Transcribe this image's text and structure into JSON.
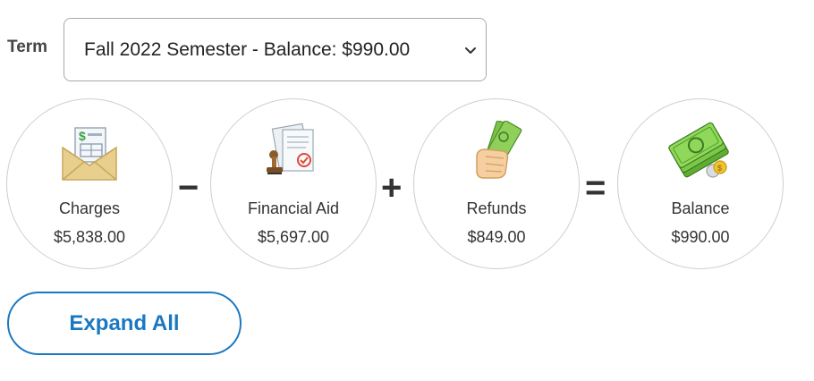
{
  "term": {
    "label": "Term",
    "selected": "Fall 2022 Semester - Balance: $990.00"
  },
  "summary": {
    "items": [
      {
        "label": "Charges",
        "amount": "$5,838.00",
        "icon": "envelope-bill-icon"
      },
      {
        "label": "Financial Aid",
        "amount": "$5,697.00",
        "icon": "documents-stamp-icon"
      },
      {
        "label": "Refunds",
        "amount": "$849.00",
        "icon": "hand-cash-icon"
      },
      {
        "label": "Balance",
        "amount": "$990.00",
        "icon": "money-stack-icon"
      }
    ],
    "operators": [
      "−",
      "+",
      "="
    ]
  },
  "actions": {
    "expand_all": "Expand All"
  },
  "colors": {
    "accent": "#1a78c2",
    "money_green": "#6cc33a",
    "circle_border": "#cfcfcf"
  }
}
